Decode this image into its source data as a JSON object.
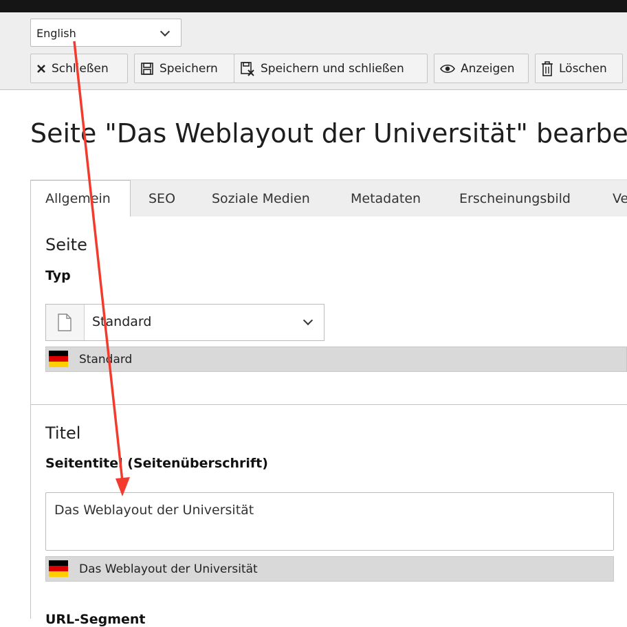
{
  "header": {
    "language": {
      "selected": "English"
    },
    "buttons": {
      "close": "Schließen",
      "save": "Speichern",
      "save_close": "Speichern und schließen",
      "view": "Anzeigen",
      "delete": "Löschen"
    }
  },
  "page": {
    "title": "Seite \"Das Weblayout der Universität\" bearbe"
  },
  "tabs": [
    "Allgemein",
    "SEO",
    "Soziale Medien",
    "Metadaten",
    "Erscheinungsbild",
    "Ve"
  ],
  "sections": {
    "page": {
      "title": "Seite",
      "type_label": "Typ",
      "type_value": "Standard",
      "type_reference": "Standard"
    },
    "titel": {
      "title": "Titel",
      "label": "Seitentitel (Seitenüberschrift)",
      "value": "Das Weblayout der Universität",
      "reference": "Das Weblayout der Universität",
      "next_label": "URL-Segment"
    }
  },
  "colors": {
    "annotation_arrow": "#f23b2c",
    "flag_black": "#000000",
    "flag_red": "#dd0000",
    "flag_gold": "#ffce00"
  },
  "icons": [
    "close-icon",
    "save-icon",
    "save-close-icon",
    "eye-icon",
    "trash-icon",
    "document-icon",
    "chevron-down-icon",
    "german-flag-icon"
  ]
}
